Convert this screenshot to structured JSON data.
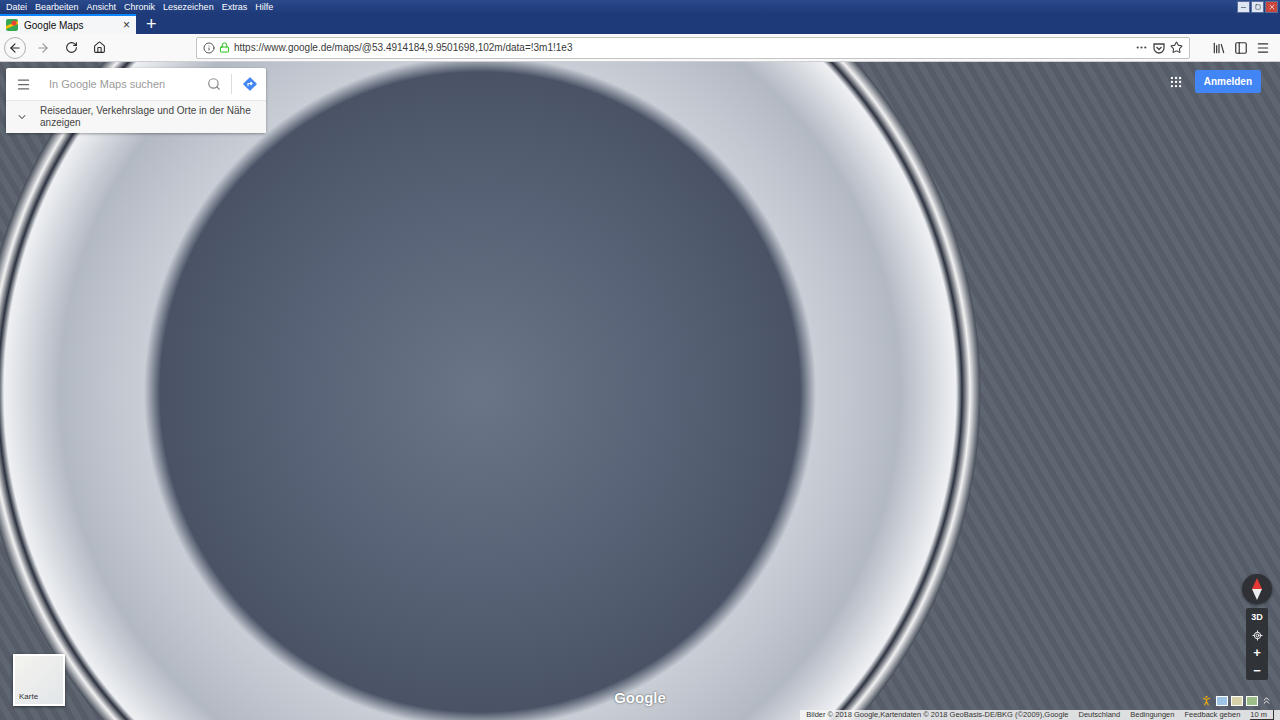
{
  "window": {
    "menu_bar": [
      "Datei",
      "Bearbeiten",
      "Ansicht",
      "Chronik",
      "Lesezeichen",
      "Extras",
      "Hilfe"
    ]
  },
  "tabs": [
    {
      "label": "Google Maps",
      "selected": true,
      "close": "×"
    }
  ],
  "new_tab": "+",
  "address_bar": {
    "url": "https://www.google.de/maps/@53.4914184,9.9501698,102m/data=!3m1!1e3",
    "secure": true,
    "bookmarked": false
  },
  "map": {
    "search": {
      "placeholder": "In Google Maps suchen"
    },
    "nearby_hint": "Reisedauer, Verkehrslage und Orte in der Nähe anzeigen",
    "sign_in": "Anmelden",
    "layer_toggle": "Karte",
    "logo": "Google",
    "controls": {
      "tilt": "3D",
      "zoom_in": "+",
      "zoom_out": "−"
    },
    "attribution": [
      "Bilder © 2018 Google,Kartendaten © 2018 GeoBasis-DE/BKG (©2009),Google",
      "Deutschland",
      "Bedingungen",
      "Feedback geben"
    ],
    "scale": "10 m"
  }
}
